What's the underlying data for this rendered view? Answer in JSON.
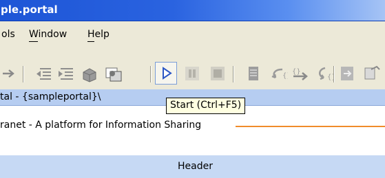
{
  "window": {
    "title": "ple.portal"
  },
  "menu": [
    {
      "label": "ols",
      "mnemonic": ""
    },
    {
      "label": "Window",
      "mnemonic": "W"
    },
    {
      "label": "Help",
      "mnemonic": "H"
    }
  ],
  "toolbar": {
    "icons": [
      "arrow-right-icon",
      "outdent-icon",
      "indent-icon",
      "package-icon",
      "deploy-icon",
      "start-icon",
      "pause-icon",
      "stop-icon",
      "breakpoint-icon",
      "step-into-icon",
      "step-over-icon",
      "step-return-icon",
      "run-to-icon"
    ],
    "tooltip": "Start (Ctrl+F5)"
  },
  "path": {
    "text": "tal - {sampleportal}\\"
  },
  "page": {
    "site_title": "ranet - A platform for Information Sharing",
    "header_label": "Header"
  },
  "colors": {
    "titlebar": "#2a63e0",
    "accent_line": "#f08c2a",
    "pathbar": "#b6cdf1",
    "header_region": "#c6d9f4"
  }
}
